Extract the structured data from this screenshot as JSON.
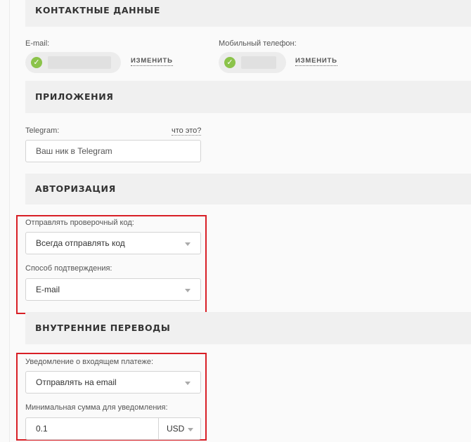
{
  "contacts": {
    "title": "КОНТАКТНЫЕ ДАННЫЕ",
    "email_label": "E-mail:",
    "email_change": "ИЗМЕНИТЬ",
    "phone_label": "Мобильный телефон:",
    "phone_change": "ИЗМЕНИТЬ",
    "status_color": "#8bc34a"
  },
  "apps": {
    "title": "ПРИЛОЖЕНИЯ",
    "telegram_label": "Telegram:",
    "whats_this": "что это?",
    "telegram_placeholder": "Ваш ник в Telegram"
  },
  "auth": {
    "title": "АВТОРИЗАЦИЯ",
    "send_code_label": "Отправлять проверочный код:",
    "send_code_value": "Всегда отправлять код",
    "confirm_label": "Способ подтверждения:",
    "confirm_value": "E-mail"
  },
  "transfers": {
    "title": "ВНУТРЕННИЕ ПЕРЕВОДЫ",
    "notify_label": "Уведомление о входящем платеже:",
    "notify_value": "Отправлять на email",
    "min_sum_label": "Минимальная сумма для уведомления:",
    "min_sum_value": "0.1",
    "currency_value": "USD"
  },
  "highlight_color": "#d81f26"
}
